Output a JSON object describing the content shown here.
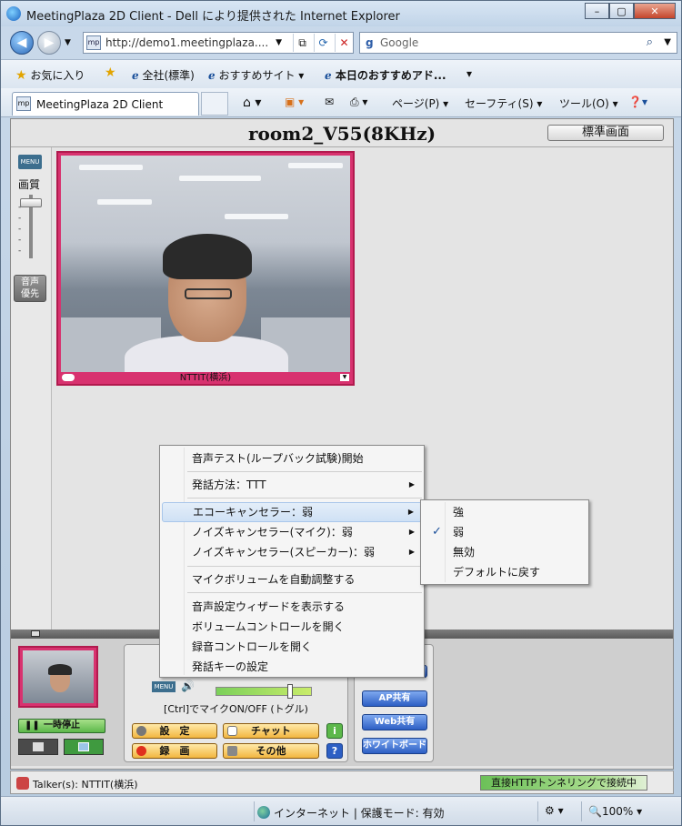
{
  "window": {
    "title": "MeetingPlaza 2D Client - Dell により提供された Internet Explorer",
    "controls": [
      "–",
      "▢",
      "✕"
    ]
  },
  "address_bar": {
    "url": "http://demo1.meetingplaza....",
    "search_placeholder": "Google"
  },
  "favorites_bar": {
    "favorites_label": "お気に入り",
    "items": [
      "全社(標準)",
      "おすすめサイト ▾",
      "本日のおすすめアド..."
    ],
    "more": "▾"
  },
  "command_bar": {
    "tab_title": "MeetingPlaza 2D Client",
    "page_menu": "ページ(P) ▾",
    "safety_menu": "セーフティ(S) ▾",
    "tools_menu": "ツール(O) ▾"
  },
  "app": {
    "room_title": "room2_V55(8KHz)",
    "standard_view_button": "標準画面",
    "left_panel": {
      "menu_label": "MENU",
      "quality_label": "画質",
      "voice_priority_button": "音声\n優先"
    },
    "video": {
      "participant_name": "NTTIT(横浜)"
    },
    "controls": {
      "pause_button": "一時停止",
      "menu_label": "MENU",
      "mic_toggle_hint": "[Ctrl]でマイクON/OFF (トグル)",
      "settings_button": "設　定",
      "chat_button": "チャット",
      "record_button": "録　画",
      "other_button": "その他",
      "ap_share_button": "AP共有",
      "web_share_button": "Web共有",
      "whiteboard_button": "ホワイトボード"
    },
    "talker_status": "Talker(s): NTTIT(横浜)",
    "connection_status": "直接HTTPトンネリングで接続中"
  },
  "context_menu": {
    "items": [
      {
        "label": "音声テスト(ループバック試験)開始",
        "has_submenu": false
      },
      {
        "label": "発話方法：TTT",
        "has_submenu": true
      },
      {
        "label": "エコーキャンセラー：弱",
        "has_submenu": true,
        "highlighted": true
      },
      {
        "label": "ノイズキャンセラー(マイク)：弱",
        "has_submenu": true
      },
      {
        "label": "ノイズキャンセラー(スピーカー)：弱",
        "has_submenu": true
      },
      {
        "label": "マイクボリュームを自動調整する",
        "has_submenu": false
      },
      {
        "label": "音声設定ウィザードを表示する",
        "has_submenu": false
      },
      {
        "label": "ボリュームコントロールを開く",
        "has_submenu": false
      },
      {
        "label": "録音コントロールを開く",
        "has_submenu": false
      },
      {
        "label": "発話キーの設定",
        "has_submenu": false
      }
    ],
    "submenu": {
      "items": [
        "強",
        "弱",
        "無効",
        "デフォルトに戻す"
      ],
      "checked": "弱"
    }
  },
  "status_bar": {
    "zone": "インターネット | 保護モード: 有効",
    "zoom": "100%"
  },
  "colors": {
    "video_frame": "#d8326f",
    "button_green": "#5cb84a",
    "button_orange": "#f2b640",
    "button_blue": "#2d5fc4",
    "menu_highlight": "#cfe1f5"
  }
}
